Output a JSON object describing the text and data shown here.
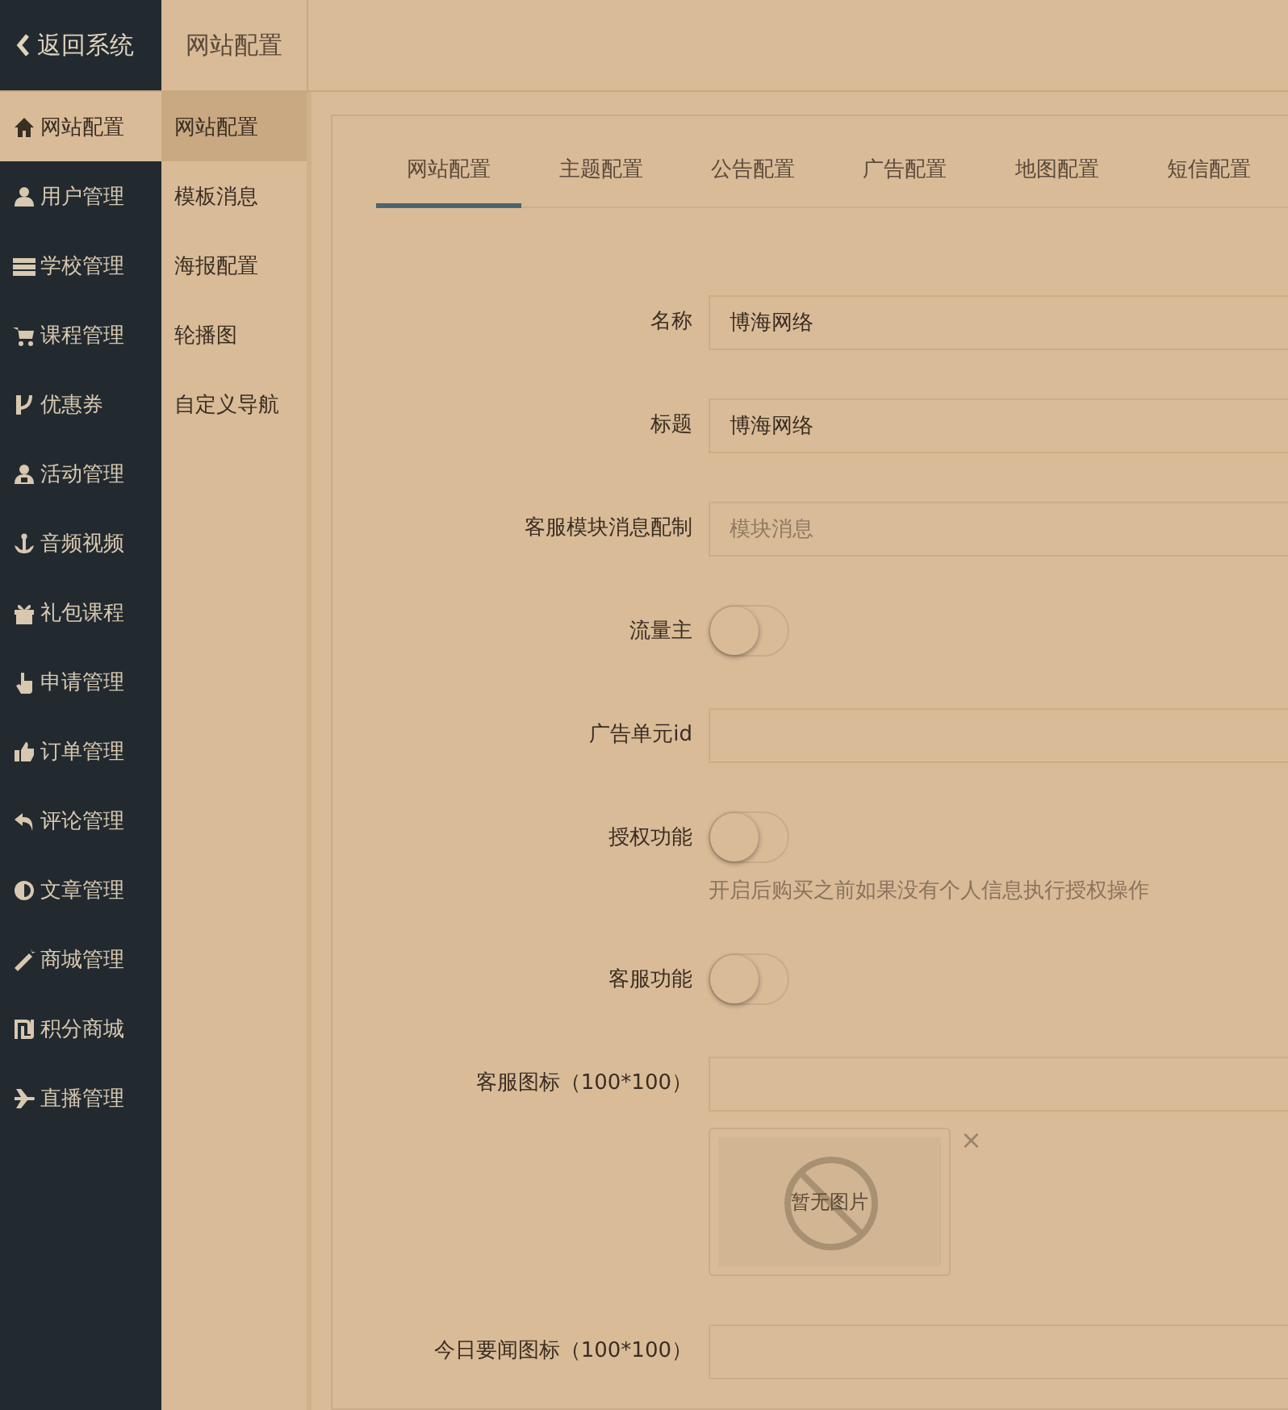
{
  "header": {
    "back_label": "返回系统",
    "title": "网站配置"
  },
  "sidebar": {
    "items": [
      {
        "label": "网站配置",
        "selected": true
      },
      {
        "label": "用户管理",
        "selected": false
      },
      {
        "label": "学校管理",
        "selected": false
      },
      {
        "label": "课程管理",
        "selected": false
      },
      {
        "label": "优惠券",
        "selected": false
      },
      {
        "label": "活动管理",
        "selected": false
      },
      {
        "label": "音频视频",
        "selected": false
      },
      {
        "label": "礼包课程",
        "selected": false
      },
      {
        "label": "申请管理",
        "selected": false
      },
      {
        "label": "订单管理",
        "selected": false
      },
      {
        "label": "评论管理",
        "selected": false
      },
      {
        "label": "文章管理",
        "selected": false
      },
      {
        "label": "商城管理",
        "selected": false
      },
      {
        "label": "积分商城",
        "selected": false
      },
      {
        "label": "直播管理",
        "selected": false
      }
    ]
  },
  "submenu": {
    "items": [
      {
        "label": "网站配置",
        "selected": true
      },
      {
        "label": "模板消息",
        "selected": false
      },
      {
        "label": "海报配置",
        "selected": false
      },
      {
        "label": "轮播图",
        "selected": false
      },
      {
        "label": "自定义导航",
        "selected": false
      }
    ]
  },
  "tabs": [
    {
      "label": "网站配置",
      "selected": true
    },
    {
      "label": "主题配置",
      "selected": false
    },
    {
      "label": "公告配置",
      "selected": false
    },
    {
      "label": "广告配置",
      "selected": false
    },
    {
      "label": "地图配置",
      "selected": false
    },
    {
      "label": "短信配置",
      "selected": false
    }
  ],
  "form": {
    "fields": [
      {
        "kind": "text",
        "label": "名称",
        "value": "博海网络"
      },
      {
        "kind": "text",
        "label": "标题",
        "value": "博海网络"
      },
      {
        "kind": "text",
        "label": "客服模块消息配制",
        "placeholder": "模块消息"
      },
      {
        "kind": "switch",
        "label": "流量主",
        "on": false
      },
      {
        "kind": "text",
        "label": "广告单元id"
      },
      {
        "kind": "switch",
        "label": "授权功能",
        "on": false,
        "hint": "开启后购买之前如果没有个人信息执行授权操作"
      },
      {
        "kind": "switch",
        "label": "客服功能",
        "on": false
      },
      {
        "kind": "image",
        "label": "客服图标（100*100）",
        "preview_text": "暂无图片",
        "remove": "×"
      },
      {
        "kind": "text",
        "label": "今日要闻图标（100*100）"
      }
    ]
  }
}
